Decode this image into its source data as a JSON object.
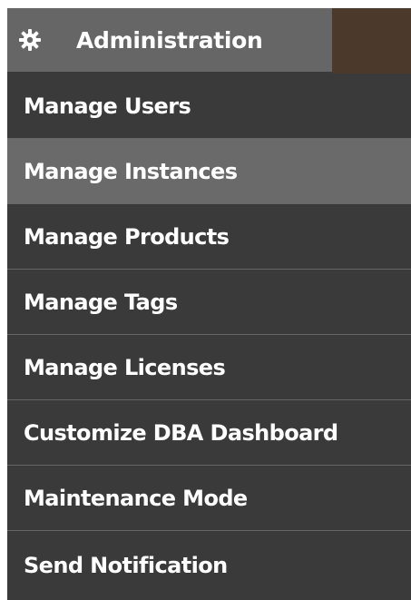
{
  "header": {
    "label": "Administration",
    "icon": "gear-icon"
  },
  "menu": {
    "selected_index": 1,
    "items": [
      {
        "label": "Manage Users"
      },
      {
        "label": "Manage Instances"
      },
      {
        "label": "Manage Products"
      },
      {
        "label": "Manage Tags"
      },
      {
        "label": "Manage Licenses"
      },
      {
        "label": "Customize DBA Dashboard"
      },
      {
        "label": "Maintenance Mode"
      },
      {
        "label": "Send Notification"
      }
    ]
  },
  "colors": {
    "header_bg": "#666666",
    "header_right_bg": "#4b3a2c",
    "menu_bg": "#3a3a3a",
    "selected_bg": "#6a6a6a",
    "text": "#ffffff"
  }
}
